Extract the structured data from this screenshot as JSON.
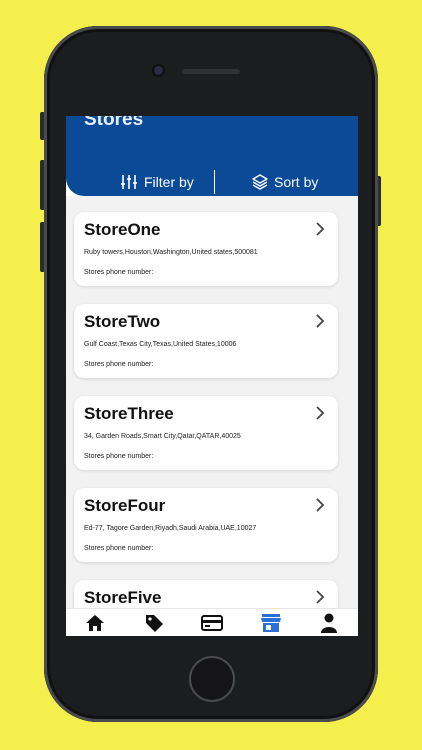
{
  "colors": {
    "background": "#f4ef4d",
    "header": "#0b4a97",
    "active_nav": "#2a6fd6"
  },
  "screen": {
    "header": {
      "title": "Stores",
      "filter_label": "Filter by",
      "sort_label": "Sort by"
    },
    "stores": [
      {
        "name": "StoreOne",
        "address": "Ruby towers,Houston,Washington,United states,500081",
        "phone_label": "Stores phone number:"
      },
      {
        "name": "StoreTwo",
        "address": "Gulf Coast,Texas City,Texas,United States,10006",
        "phone_label": "Stores phone number:"
      },
      {
        "name": "StoreThree",
        "address": "34, Garden Roads,Smart City,Qatar,QATAR,40025",
        "phone_label": "Stores phone number:"
      },
      {
        "name": "StoreFour",
        "address": "Ed-77, Tagore Garden,Riyadh,Saudi Arabia,UAE,10027",
        "phone_label": "Stores phone number:"
      },
      {
        "name": "StoreFive",
        "address": "",
        "phone_label": ""
      }
    ],
    "nav": {
      "items": [
        "home-icon",
        "tag-icon",
        "card-icon",
        "store-icon",
        "person-icon"
      ],
      "active": "store-icon"
    }
  }
}
